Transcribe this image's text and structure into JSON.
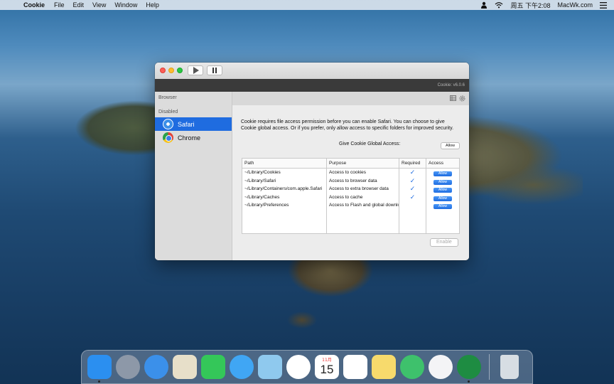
{
  "menubar": {
    "app_name": "Cookie",
    "items": [
      "File",
      "Edit",
      "View",
      "Window",
      "Help"
    ],
    "clock": "周五 下午2:08",
    "brand": "MacWk.com"
  },
  "window": {
    "version": "Cookie: v6.0.6",
    "sidebar": {
      "header": "Browser",
      "section": "Disabled",
      "items": [
        {
          "label": "Safari",
          "icon": "safari-icon"
        },
        {
          "label": "Chrome",
          "icon": "chrome-icon"
        }
      ]
    },
    "description": "Cookie requires file access permission before you can enable Safari. You can choose to give Cookie global access. Or if you prefer, only allow access to specific folders for improved security.",
    "global_access_label": "Give Cookie Global Access:",
    "global_allow_label": "Allow",
    "table": {
      "headers": [
        "Path",
        "Purpose",
        "Required",
        "Access"
      ],
      "rows": [
        {
          "path": "~/Library/Cookies",
          "purpose": "Access to cookies",
          "required": "✓",
          "access": "Allow"
        },
        {
          "path": "~/Library/Safari",
          "purpose": "Access to browser data",
          "required": "✓",
          "access": "Allow"
        },
        {
          "path": "~/Library/Containers/com.apple.Safari",
          "purpose": "Access to extra browser data",
          "required": "✓",
          "access": "Allow"
        },
        {
          "path": "~/Library/Caches",
          "purpose": "Access to cache",
          "required": "✓",
          "access": "Allow"
        },
        {
          "path": "~/Library/Preferences",
          "purpose": "Access to Flash and global downloads",
          "required": "",
          "access": "Allow"
        }
      ]
    },
    "enable_label": "Enable"
  },
  "dock": {
    "apps": [
      {
        "name": "finder-icon",
        "color": "#2b8ff0",
        "running": true
      },
      {
        "name": "launchpad-icon",
        "color": "#8d98a8",
        "running": false
      },
      {
        "name": "safari-icon",
        "color": "#3b90ea",
        "running": false
      },
      {
        "name": "mail-icon",
        "color": "#e7dfc9",
        "running": false
      },
      {
        "name": "facetime-icon",
        "color": "#34c759",
        "running": false
      },
      {
        "name": "messages-icon",
        "color": "#40a6f4",
        "running": false
      },
      {
        "name": "maps-icon",
        "color": "#8fc9ee",
        "running": false
      },
      {
        "name": "photos-icon",
        "color": "#ffffff",
        "running": false
      },
      {
        "name": "calendar-icon",
        "color": "#ffffff",
        "running": false
      },
      {
        "name": "reminders-icon",
        "color": "#ffffff",
        "running": false
      },
      {
        "name": "notes-icon",
        "color": "#f7da6c",
        "running": false
      },
      {
        "name": "find-my-icon",
        "color": "#3ec16c",
        "running": false
      },
      {
        "name": "music-icon",
        "color": "#f4f4f6",
        "running": false
      },
      {
        "name": "cookie-app-icon",
        "color": "#1e8c42",
        "running": true
      },
      {
        "name": "trash-icon",
        "color": "#d7dde3",
        "running": false
      }
    ],
    "calendar_month": "11月",
    "calendar_day": "15"
  }
}
